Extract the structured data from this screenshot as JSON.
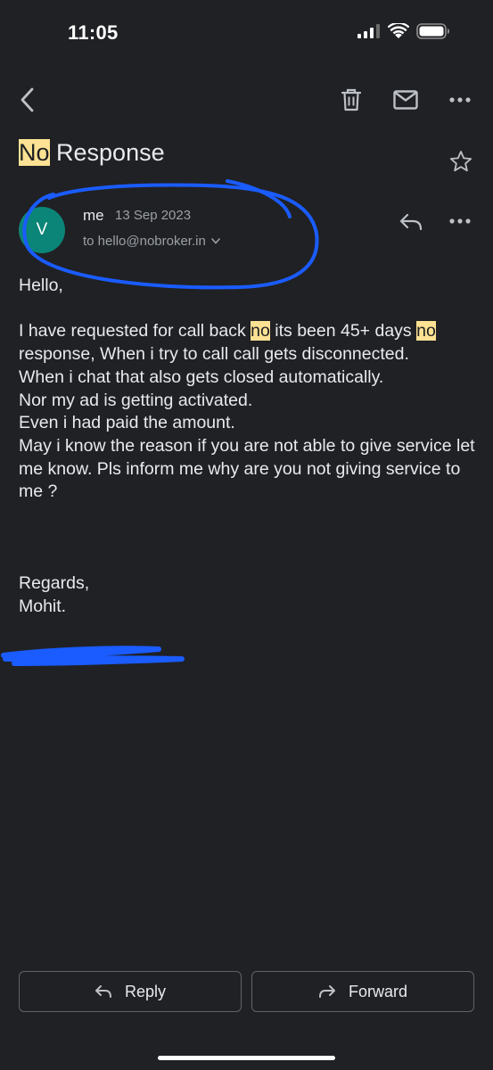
{
  "status_bar": {
    "time": "11:05"
  },
  "toolbar": {
    "back_icon": "chevron-left-icon",
    "delete_icon": "trash-icon",
    "mark_unread_icon": "mail-icon",
    "more_icon": "more-horizontal-icon"
  },
  "email": {
    "subject_highlight": "No",
    "subject_rest": " Response",
    "avatar_letter": "V",
    "avatar_color": "#0b8577",
    "sender": "me",
    "date": "13 Sep 2023",
    "recipient": "to hello@nobroker.in",
    "body": {
      "greeting": "Hello,",
      "p1_a": "I have requested for call back ",
      "p1_hl1": "no",
      "p1_b": " its been 45+ days ",
      "p1_hl2": "no",
      "p1_c": " response, When i try to call call gets disconnected.",
      "line2": "When i chat that also gets closed automatically.",
      "line3": "Nor my ad is getting activated.",
      "line4": "Even i had paid the amount.",
      "line5": "May i know the reason if you are not able to give service let me know. Pls inform me why are you not giving service to me ?",
      "regards": "Regards,",
      "name": "Mohit."
    }
  },
  "actions": {
    "reply_label": "Reply",
    "forward_label": "Forward"
  },
  "colors": {
    "background": "#202124",
    "highlight": "#fde293",
    "scribble": "#1a5cff"
  }
}
